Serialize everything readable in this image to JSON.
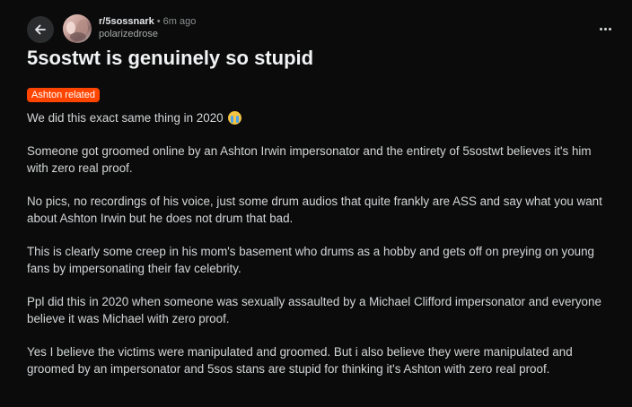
{
  "post": {
    "subreddit": "r/5sossnark",
    "separator": "•",
    "time": "6m ago",
    "username": "polarizedrose",
    "title": "5sostwt is genuinely so stupid",
    "flair": "Ashton related",
    "flair_color": "#ff4500",
    "paragraphs": [
      "We did this exact same thing in 2020",
      "Someone got groomed online by an Ashton Irwin impersonator and the entirety of 5sostwt believes it's him with zero real proof.",
      "No pics, no recordings of his voice, just some drum audios that quite frankly are ASS and say what you want about Ashton Irwin but he does not drum that bad.",
      "This is clearly some creep in his mom's basement who drums as a hobby and gets off on preying on young fans by impersonating their fav celebrity.",
      "Ppl did this in 2020 when someone was sexually assaulted by a Michael Clifford impersonator and everyone believe it was Michael with zero proof.",
      "Yes I believe the victims were manipulated and groomed. But i also believe they were manipulated and groomed by an impersonator and 5sos stans are stupid for thinking it's Ashton with zero real proof."
    ]
  },
  "icons": {
    "back": "arrow-left-icon",
    "more": "more-vertical-icon",
    "emoji": "crying-face-emoji"
  }
}
